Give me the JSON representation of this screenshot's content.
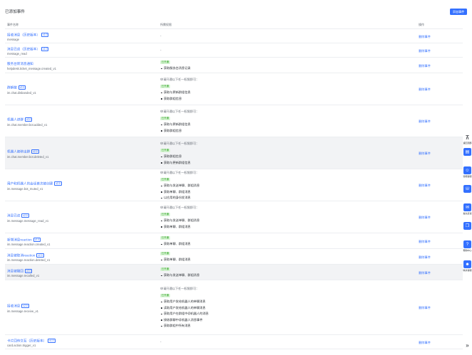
{
  "page": {
    "title": "已添加事件",
    "add_button": "添加事件"
  },
  "table": {
    "headers": {
      "name": "事件名称",
      "permission": "所需权限",
      "op": "操作"
    },
    "delete_label": "删除事件",
    "rows": [
      {
        "label": "接收消息（历史版本）",
        "version": "v1.0",
        "code": "message",
        "perm_hint": "",
        "group": "",
        "perms": [],
        "dash": "-"
      },
      {
        "label": "消息已读（历史版本）",
        "version": "v1.0",
        "code": "message_read",
        "perm_hint": "",
        "group": "",
        "perms": [],
        "dash": "-"
      },
      {
        "label": "服务台新消息通知",
        "version": "",
        "code": "helpdesk.ticket_message.created_v1",
        "perm_hint": "",
        "group": "已开通",
        "perms": [
          "获取服务台消息记录"
        ],
        "dash": ""
      },
      {
        "label": "群解散",
        "version": "v2.0",
        "code": "im.chat.disbanded_v1",
        "perm_hint": "申请开通以下任一权限即可：",
        "group": "已开通",
        "perms": [
          "获取与更新群组信息",
          "获取群组信息"
        ],
        "dash": ""
      },
      {
        "label": "机器人进群",
        "version": "v2.0",
        "code": "im.chat.member.bot.added_v1",
        "perm_hint": "申请开通以下任一权限即可：",
        "group": "已开通",
        "perms": [
          "获取与更新群组信息",
          "获取群组信息"
        ],
        "dash": ""
      },
      {
        "label": "机器人被移出群",
        "version": "v2.0",
        "code": "im.chat.member.bot.deleted_v1",
        "perm_hint": "申请开通以下任一权限即可：",
        "group": "已开通",
        "perms": [
          "获取群组信息",
          "获取与更新群组信息"
        ],
        "dash": "",
        "highlight": true
      },
      {
        "label": "用户和机器人的会话首次被创建",
        "version": "v2.0",
        "code": "im.message.bot_muted_v1",
        "perm_hint": "申请开通以下任一权限即可：",
        "group": "已开通",
        "perms": [
          "获取与发送单聊、群组消息",
          "获取单聊、群组消息",
          "以应用的身份发消息"
        ],
        "dash": ""
      },
      {
        "label": "消息已读",
        "version": "v2.0",
        "code": "im.message.message_read_v1",
        "perm_hint": "申请开通以下任一权限即可：",
        "group": "已开通",
        "perms": [
          "获取与发送单聊、群组消息",
          "获取单聊、群组消息"
        ],
        "dash": ""
      },
      {
        "label": "新增消息reaction",
        "version": "v2.0",
        "code": "im.message.reaction.created_v1",
        "perm_hint": "",
        "group": "已开通",
        "perms": [
          "获取单聊、群组消息"
        ],
        "dash": ""
      },
      {
        "label": "消息被取消reaction",
        "version": "v2.0",
        "code": "im.message.reaction.deleted_v1",
        "perm_hint": "",
        "group": "已开通",
        "perms": [
          "获取单聊、群组消息"
        ],
        "dash": ""
      },
      {
        "label": "消息被撤回",
        "version": "v2.0",
        "code": "im.message.recalled_v1",
        "perm_hint": "",
        "group": "已开通",
        "perms": [
          "获取与发送单聊、群组消息"
        ],
        "dash": "",
        "highlight": true
      },
      {
        "label": "接收消息",
        "version": "v2.0",
        "code": "im.message.receive_v1",
        "perm_hint": "申请开通以下任一权限即可：",
        "group": "已开通",
        "perms": [
          "获取用户发给机器人的单聊消息",
          "读取用户发给机器人的单聊消息",
          "获取用户在群组中@机器人的消息",
          "接收群聊中@机器人消息事件",
          "获取群组中所有消息"
        ],
        "dash": ""
      },
      {
        "label": "卡片回传交互（历史版本）",
        "version": "v1.0",
        "code": "card.action.trigger_v1",
        "perm_hint": "",
        "group": "",
        "perms": [],
        "dash": "-"
      }
    ]
  },
  "sidebar": {
    "items": [
      {
        "icon": "arrow-up-icon",
        "glyph": "⊼",
        "label": "返回顶部"
      },
      {
        "icon": "doc-icon",
        "glyph": "▤",
        "label": ""
      },
      {
        "icon": "bot-icon",
        "glyph": "☺",
        "label": "智能客服"
      },
      {
        "icon": "headset-icon",
        "glyph": "☏",
        "label": ""
      },
      {
        "icon": "chat-icon",
        "glyph": "✉",
        "label": "提交反馈"
      },
      {
        "icon": "book-icon",
        "glyph": "❐",
        "label": ""
      },
      {
        "icon": "help-icon",
        "glyph": "?",
        "label": "帮助中心"
      },
      {
        "icon": "user-icon",
        "glyph": "☻",
        "label": "联系客服"
      },
      {
        "icon": "expand-icon",
        "glyph": "»",
        "label": ""
      }
    ]
  }
}
